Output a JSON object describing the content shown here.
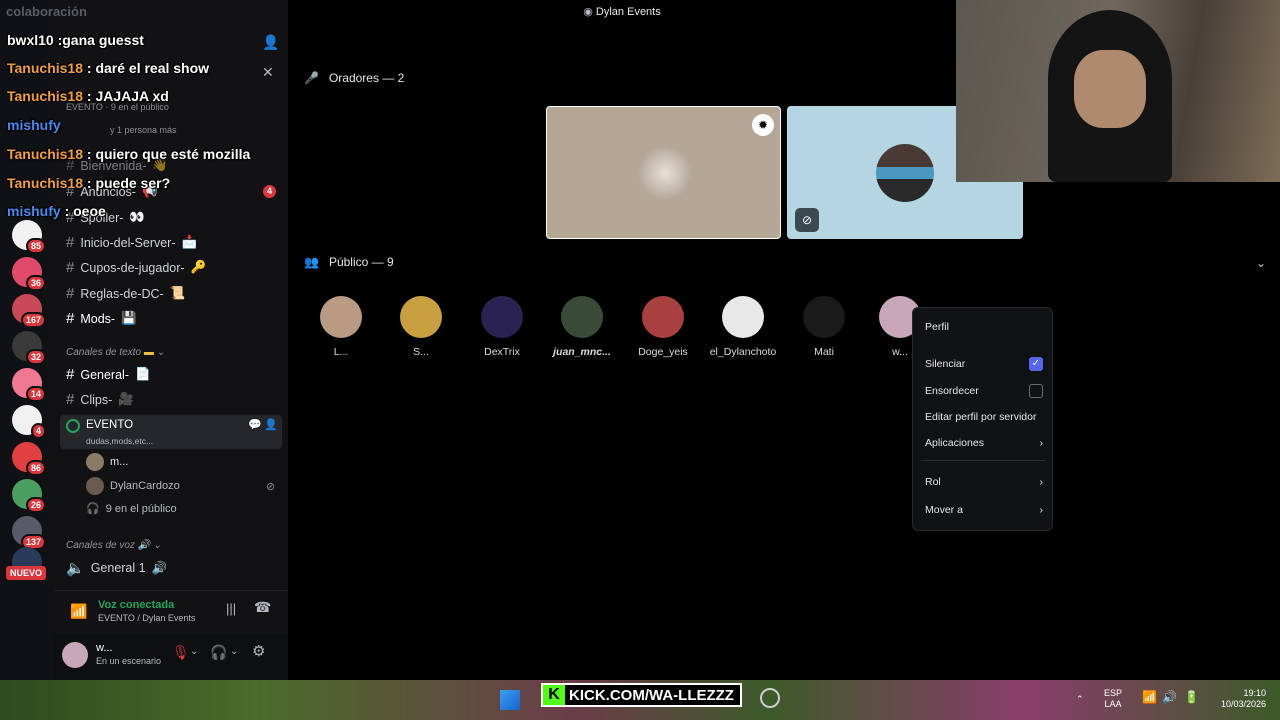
{
  "window_title": "Dylan Events",
  "rail": {
    "badges": [
      "85",
      "36",
      "167",
      "32",
      "14",
      "4",
      "86",
      "26",
      "137"
    ],
    "new_label": "NUEVO"
  },
  "sidebar": {
    "top_label": "colaboración",
    "event_header": {
      "title": "EVENTO",
      "subtitle": "EVENTO · 9 en el público",
      "more": "y 1 persona más"
    },
    "channels": [
      {
        "name": "Bienvenida-",
        "emoji": "👋"
      },
      {
        "name": "Anuncios-",
        "emoji": "📢",
        "badge": "4"
      },
      {
        "name": "Spoiler-",
        "emoji": "👀"
      },
      {
        "name": "Inicio-del-Server-",
        "emoji": "📩"
      },
      {
        "name": "Cupos-de-jugador-",
        "emoji": "🔑"
      },
      {
        "name": "Reglas-de-DC-",
        "emoji": "📜"
      },
      {
        "name": "Mods-",
        "emoji": "💾"
      }
    ],
    "text_category": "Canales de texto",
    "text_channels": [
      {
        "name": "General-",
        "emoji": "📄"
      },
      {
        "name": "Clips-",
        "emoji": "🎥"
      }
    ],
    "stage": {
      "name": "EVENTO",
      "topic": "dudas,mods,etc..."
    },
    "stage_users": [
      {
        "name": "m..."
      },
      {
        "name": "DylanCardozo"
      }
    ],
    "stage_audience": "9 en el público",
    "voice_category": "Canales de voz",
    "voice_channels": [
      {
        "name": "General 1"
      }
    ],
    "voice_status": {
      "title": "Voz conectada",
      "subtitle": "EVENTO / Dylan Events"
    },
    "user": {
      "name": "w...",
      "status": "En un escenario"
    }
  },
  "stage_view": {
    "speakers_label": "Oradores — 2",
    "audience_label": "Público — 9",
    "audience": [
      {
        "name": "L...",
        "color": "#b99a82"
      },
      {
        "name": "S...",
        "color": "#c9a040"
      },
      {
        "name": "DexTrix",
        "color": "#2a2250"
      },
      {
        "name": "juan_mnc...",
        "color": "#3a4a38"
      },
      {
        "name": "Doge_yeis",
        "color": "#a84040"
      },
      {
        "name": "el_Dylanchoto",
        "color": "#e8e8e8"
      },
      {
        "name": "Mati",
        "color": "#1a1a1a"
      },
      {
        "name": "w...",
        "color": "#c8a8b8"
      }
    ]
  },
  "context_menu": {
    "items": [
      {
        "label": "Perfil"
      },
      {
        "label": "Silenciar",
        "checked": true
      },
      {
        "label": "Ensordecer",
        "checked": false
      },
      {
        "label": "Editar perfil por servidor"
      },
      {
        "label": "Aplicaciones",
        "submenu": true
      },
      {
        "label": "Rol",
        "submenu": true
      },
      {
        "label": "Mover a",
        "submenu": true
      }
    ]
  },
  "chat_overlay": [
    {
      "user": "bwxl10",
      "text": ":gana guesst",
      "color": "#ffffff"
    },
    {
      "user": "Tanuchis18",
      "text": ": daré el real show",
      "color": "#f0a040"
    },
    {
      "user": "Tanuchis18",
      "text": ": JAJAJA xd",
      "color": "#f0a040"
    },
    {
      "user": "mishufy",
      "text": "",
      "color": "#4a8af0"
    },
    {
      "user": "Tanuchis18",
      "text": ": quiero que esté mozilla",
      "color": "#f0a040"
    },
    {
      "user": "Tanuchis18",
      "text": ": puede ser?",
      "color": "#f0a040"
    },
    {
      "user": "mishufy",
      "text": ": oeoe",
      "color": "#4a8af0"
    }
  ],
  "taskbar": {
    "banner": "KICK.COM/WA-LLEZZZ",
    "lang": "ESP",
    "lang2": "LAA",
    "time": "19:10",
    "date": "10/03/2026"
  },
  "colors": {
    "accent": "#5865f2",
    "green": "#23a55a",
    "danger": "#da373c"
  }
}
